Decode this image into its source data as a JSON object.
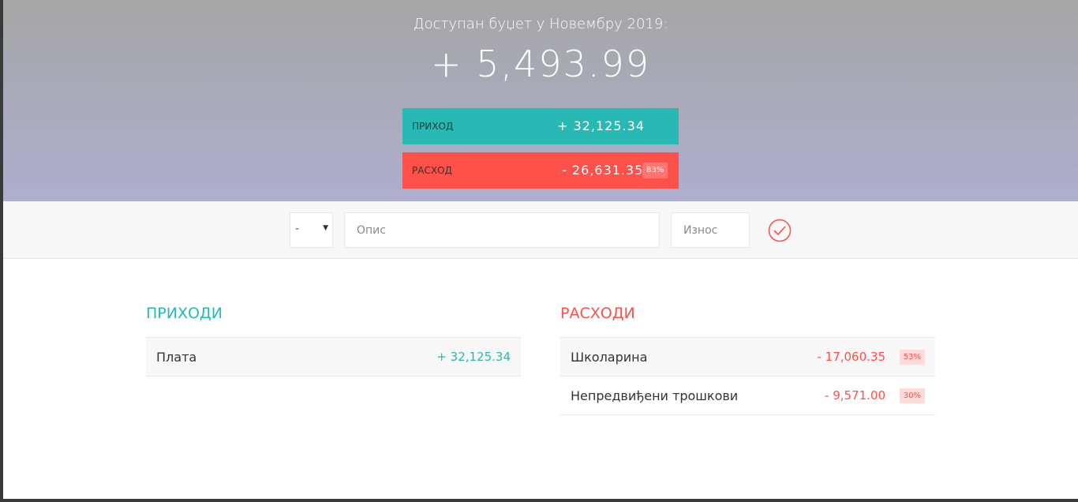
{
  "header": {
    "title": "Доступан буџет у Новембру 2019:",
    "budget": "+ 5,493.99",
    "income": {
      "label": "ПРИХОД",
      "value": "+ 32,125.34"
    },
    "expense": {
      "label": "РАСХОД",
      "value": "- 26,631.35",
      "percentage": "83%"
    }
  },
  "add_form": {
    "type_value": "-",
    "description_placeholder": "Опис",
    "amount_placeholder": "Износ"
  },
  "income_list": {
    "title": "ПРИХОДИ",
    "items": [
      {
        "description": "Плата",
        "value": "+ 32,125.34"
      }
    ]
  },
  "expense_list": {
    "title": "РАСХОДИ",
    "items": [
      {
        "description": "Школарина",
        "value": "- 17,060.35",
        "percentage": "53%"
      },
      {
        "description": "Непредвиђени трошкови",
        "value": "- 9,571.00",
        "percentage": "30%"
      }
    ]
  },
  "colors": {
    "income": "#28b9b5",
    "expense": "#ff5049"
  }
}
